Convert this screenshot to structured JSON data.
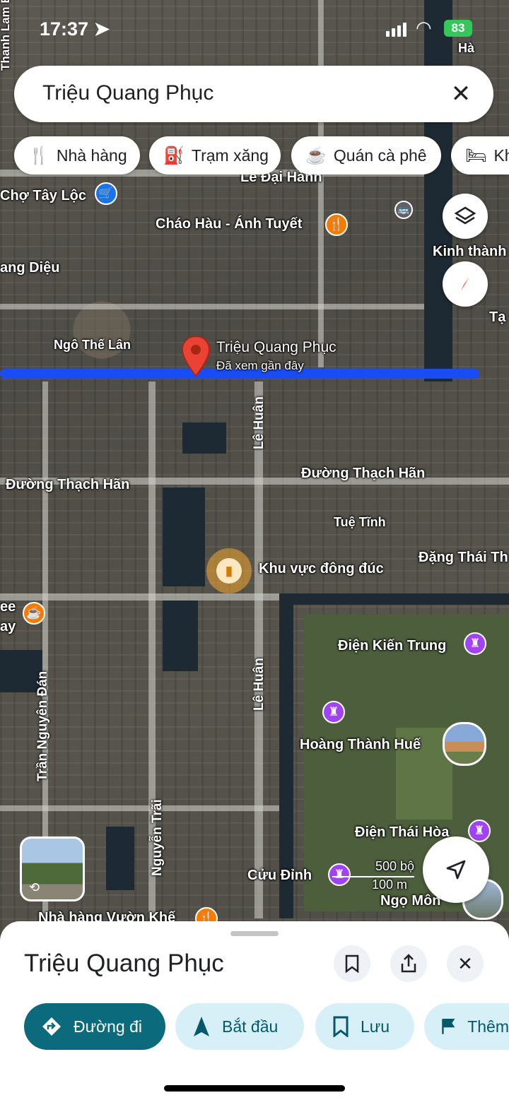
{
  "status_bar": {
    "time": "17:37",
    "battery": "83"
  },
  "search": {
    "query": "Triệu Quang Phục"
  },
  "filter_chips": [
    {
      "label": "Nhà hàng",
      "icon": "utensils-icon"
    },
    {
      "label": "Trạm xăng",
      "icon": "gas-station-icon"
    },
    {
      "label": "Quán cà phê",
      "icon": "coffee-icon"
    },
    {
      "label": "Kh",
      "icon": "bed-icon"
    }
  ],
  "map_labels": {
    "le_dai_hanh": "Lê Đại Hành",
    "cho_tay_loc": "Chợ Tây Lộc",
    "chao_hau": "Cháo Hàu - Ánh Tuyết",
    "kinh_thanh": "Kinh thành",
    "hang_dieu": "ang Diệu",
    "ngo_the_lan": "Ngô Thế Lân",
    "ta": "Tạ C",
    "le_huan_1": "Lê Huân",
    "duong_thach_han_left": "Đường Thạch Hãn",
    "duong_thach_han_right": "Đường Thạch Hãn",
    "tue_tinh": "Tuệ Tĩnh",
    "khu_vuc_dong_duc": "Khu vực đông đúc",
    "dang_thai_than": "Đặng Thái Th",
    "ee": "ee",
    "ay": "ay",
    "dien_kien_trung": "Điện Kiến Trung",
    "le_huan_2": "Lê Huân",
    "tran_nguyen_dan": "Trần Nguyên Đán",
    "hoang_thanh_hue": "Hoàng Thành Huế",
    "nguyen_trai": "Nguyễn Trãi",
    "dien_thai_hoa": "Điện Thái Hòa",
    "cuu_dinh": "Cửu Đỉnh",
    "ngo_mon": "Ngọ Môn",
    "nha_hang_vuon_khe": "Nhà hàng Vườn Khế",
    "ha": "Hà",
    "thanh_lam": "Thanh Lam B"
  },
  "pin": {
    "title": "Triệu Quang Phục",
    "subtitle": "Đã xem gần đây"
  },
  "scale": {
    "feet": "500 bộ",
    "meters": "100 m"
  },
  "sheet": {
    "title": "Triệu Quang Phục",
    "actions": [
      {
        "label": "Đường đi",
        "icon": "directions-icon"
      },
      {
        "label": "Bắt đầu",
        "icon": "navigation-arrow-icon"
      },
      {
        "label": "Lưu",
        "icon": "bookmark-icon"
      },
      {
        "label": "Thêm",
        "icon": "flag-icon"
      }
    ]
  },
  "colors": {
    "route": "#1a4cf5",
    "pin": "#ea4335",
    "primary": "#0b6a7c",
    "chip_bg": "#d7f0f7"
  }
}
